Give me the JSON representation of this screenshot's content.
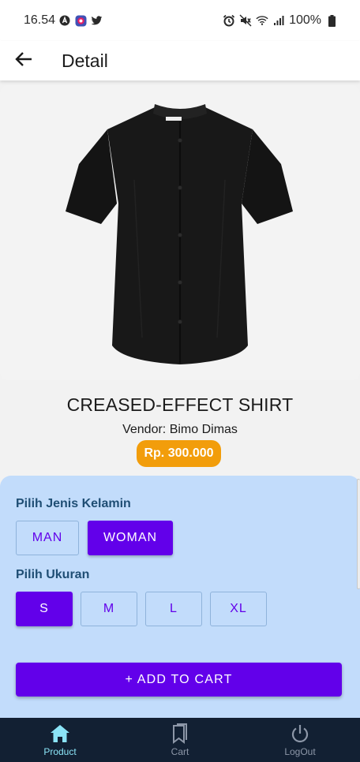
{
  "status_bar": {
    "time": "16.54",
    "battery": "100%"
  },
  "header": {
    "title": "Detail"
  },
  "product": {
    "name": "CREASED-EFFECT SHIRT",
    "vendor_label": "Vendor:",
    "vendor_name": "Bimo Dimas",
    "price": "Rp. 300.000"
  },
  "gender": {
    "label": "Pilih Jenis Kelamin",
    "options": [
      "MAN",
      "WOMAN"
    ],
    "selected": "WOMAN"
  },
  "size": {
    "label": "Pilih Ukuran",
    "options": [
      "S",
      "M",
      "L",
      "XL"
    ],
    "selected": "S"
  },
  "add_to_cart_label": "+ ADD TO CART",
  "bottom_nav": {
    "items": [
      {
        "label": "Product",
        "icon": "home-icon",
        "active": true
      },
      {
        "label": "Cart",
        "icon": "bookmark-icon",
        "active": false
      },
      {
        "label": "LogOut",
        "icon": "power-icon",
        "active": false
      }
    ]
  },
  "colors": {
    "accent": "#6200ea",
    "price_badge": "#f29d0b",
    "options_panel": "#c2dcfb",
    "bottom_nav": "#122033",
    "nav_active": "#8be4f7"
  }
}
